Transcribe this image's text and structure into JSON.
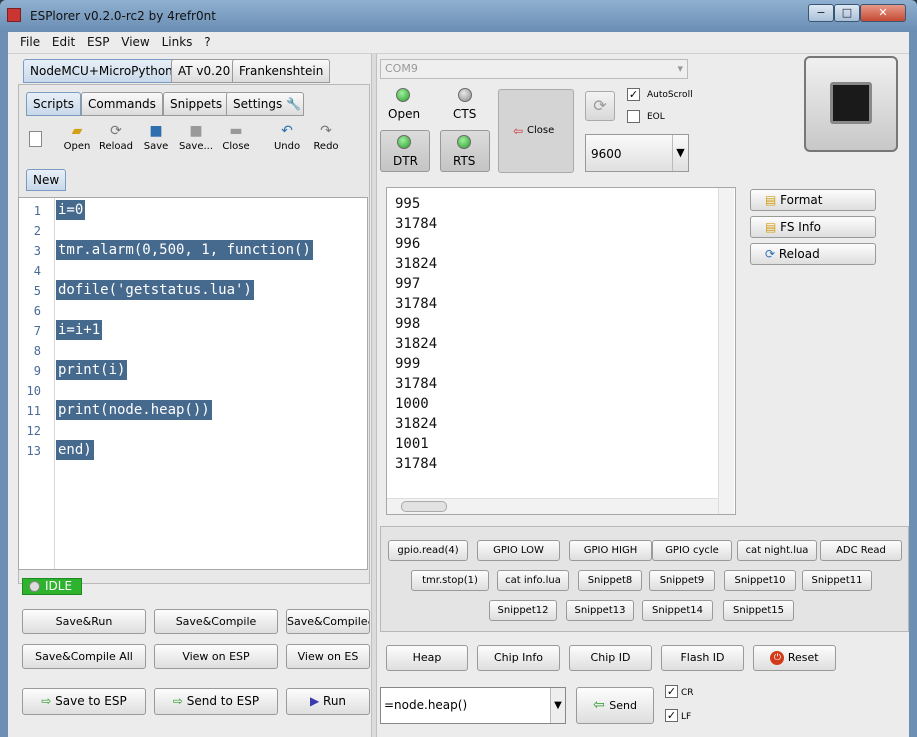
{
  "window": {
    "title": "ESPlorer v0.2.0-rc2 by 4refr0nt",
    "controls": [
      "−",
      "□",
      "✕"
    ]
  },
  "menu": [
    "File",
    "Edit",
    "ESP",
    "View",
    "Links",
    "?"
  ],
  "fw_tabs": [
    "NodeMCU+MicroPython",
    "AT v0.20",
    "Frankenshtein"
  ],
  "sub_tabs": [
    "Scripts",
    "Commands",
    "Snippets",
    "Settings"
  ],
  "toolbar": [
    {
      "label": "Open",
      "icon": "open-folder-icon"
    },
    {
      "label": "Reload",
      "icon": "reload-icon"
    },
    {
      "label": "Save",
      "icon": "save-icon"
    },
    {
      "label": "Save...",
      "icon": "save-as-icon"
    },
    {
      "label": "Close",
      "icon": "close-file-icon"
    },
    {
      "label": "Undo",
      "icon": "undo-icon"
    },
    {
      "label": "Redo",
      "icon": "redo-icon"
    }
  ],
  "file_tab": "New",
  "editor": {
    "line_numbers": [
      "1",
      "2",
      "3",
      "4",
      "5",
      "6",
      "7",
      "8",
      "9",
      "10",
      "11",
      "12",
      "13"
    ],
    "code": [
      {
        "line": 1,
        "text": "i=0"
      },
      {
        "line": 3,
        "text": "tmr.alarm(0,500, 1, function()"
      },
      {
        "line": 5,
        "text": "dofile('getstatus.lua')"
      },
      {
        "line": 7,
        "text": "i=i+1"
      },
      {
        "line": 9,
        "text": "print(i)"
      },
      {
        "line": 11,
        "text": "print(node.heap())"
      },
      {
        "line": 13,
        "text": "end)"
      }
    ]
  },
  "status": "IDLE",
  "left_buttons": {
    "row1": [
      "Save&Run",
      "Save&Compile",
      "Save&Compile&"
    ],
    "row2": [
      "Save&Compile All",
      "View on ESP",
      "View on ES"
    ],
    "row3": [
      "Save to ESP",
      "Send to ESP",
      "Run"
    ]
  },
  "port": {
    "com": "COM9",
    "open": "Open",
    "cts": "CTS",
    "dtr": "DTR",
    "rts": "RTS",
    "close": "Close",
    "autoscroll": "AutoScroll",
    "eol": "EOL",
    "baud": "9600"
  },
  "terminal": [
    "31824",
    "995",
    "31784",
    "996",
    "31824",
    "997",
    "31784",
    "998",
    "31824",
    "999",
    "31784",
    "1000",
    "31824",
    "1001",
    "31784"
  ],
  "side_buttons": [
    "Format",
    "FS Info",
    "Reload"
  ],
  "snippets": {
    "row1": [
      "gpio.read(4)",
      "GPIO LOW",
      "GPIO HIGH",
      "GPIO cycle",
      "cat night.lua",
      "ADC Read"
    ],
    "row2": [
      "tmr.stop(1)",
      "cat info.lua",
      "Snippet8",
      "Snippet9",
      "Snippet10",
      "Snippet11"
    ],
    "row3": [
      "Snippet12",
      "Snippet13",
      "Snippet14",
      "Snippet15"
    ]
  },
  "bottom_buttons": [
    "Heap",
    "Chip Info",
    "Chip ID",
    "Flash ID",
    "Reset"
  ],
  "command": {
    "value": "=node.heap()",
    "send": "Send",
    "cr": "CR",
    "lf": "LF"
  },
  "colors": {
    "selection": "#46698e",
    "led_green": "#2a9a2a",
    "status_green": "#2db32d",
    "reset_red": "#d23a1a"
  }
}
